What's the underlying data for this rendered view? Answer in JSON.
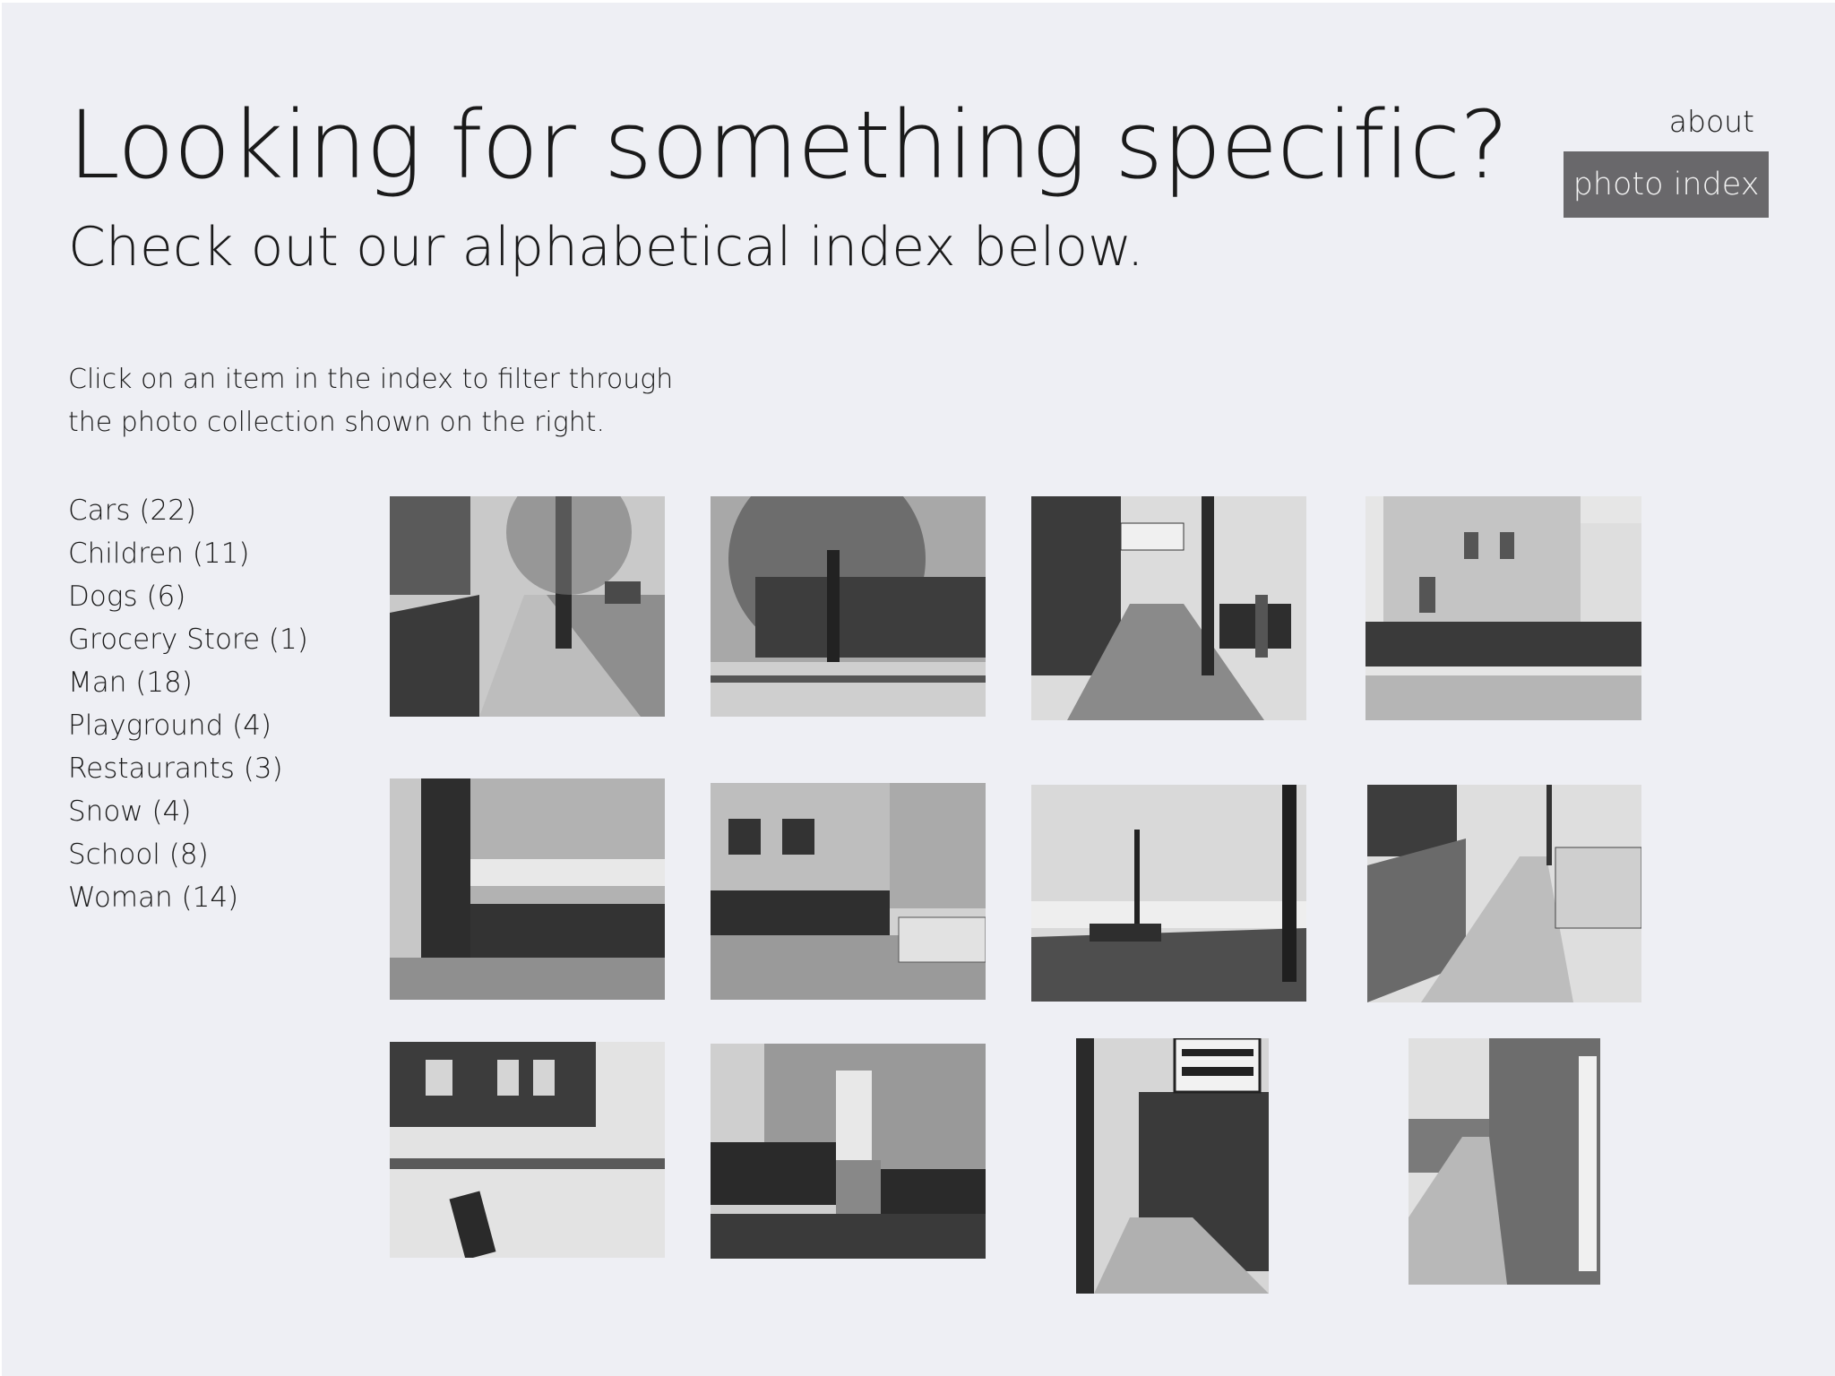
{
  "header": {
    "title": "Looking for something specific?",
    "subtitle": "Check out our alphabetical index below."
  },
  "nav": {
    "about": "about",
    "photo_index": "photo index"
  },
  "intro": {
    "line1": "Click on  an item in the index to filter through",
    "line2": "the photo collection shown on the right."
  },
  "index": [
    "Cars (22)",
    "Children (11)",
    "Dogs (6)",
    "Grocery Store (1)",
    "Man (18)",
    "Playground (4)",
    "Restaurants (3)",
    "Snow (4)",
    "School (8)",
    "Woman (14)"
  ],
  "colors": {
    "background": "#eeeff4",
    "nav_active": "#69686b"
  }
}
